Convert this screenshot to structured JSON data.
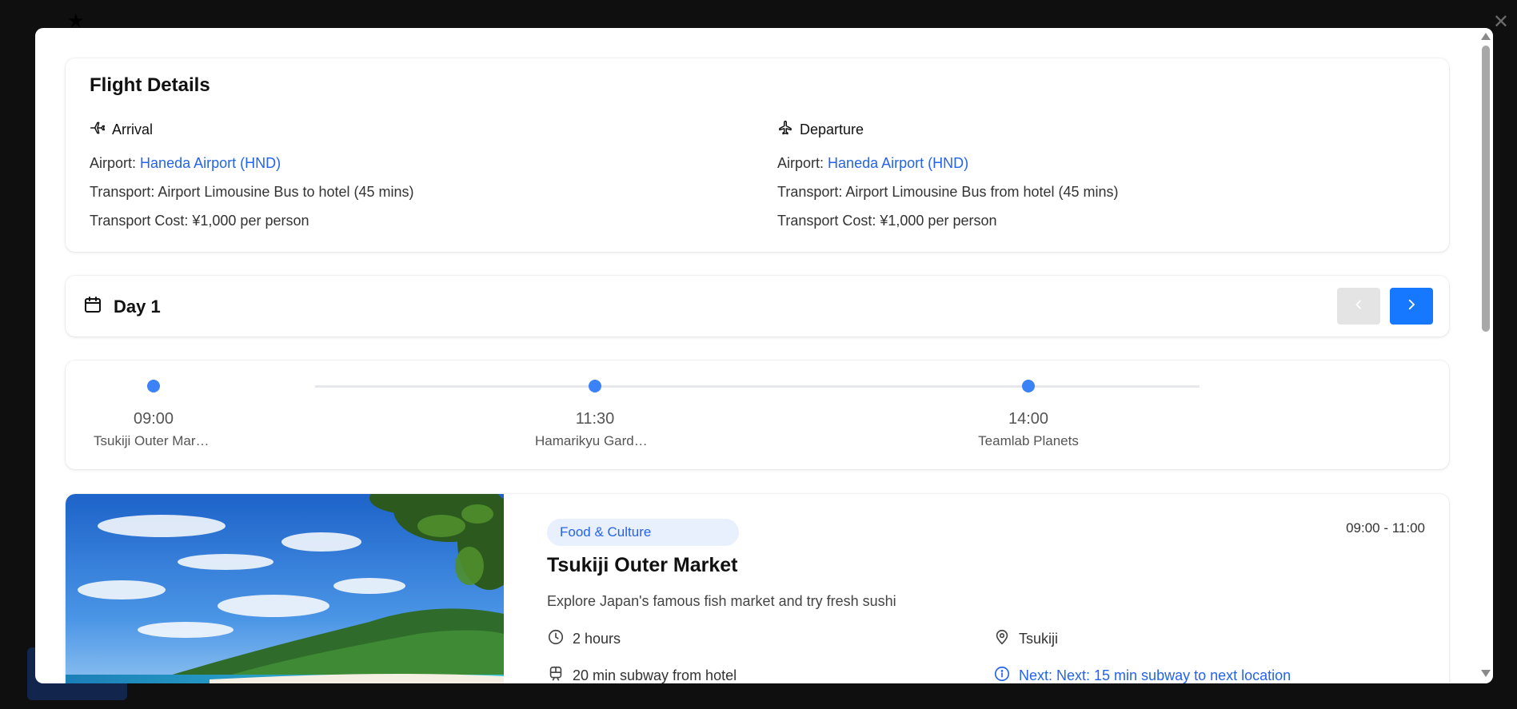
{
  "flight": {
    "title": "Flight Details",
    "arrival": {
      "label": "Arrival",
      "airport_label": "Airport:",
      "airport": "Haneda Airport (HND)",
      "transport": "Transport: Airport Limousine Bus to hotel (45 mins)",
      "cost": "Transport Cost: ¥1,000 per person"
    },
    "departure": {
      "label": "Departure",
      "airport_label": "Airport:",
      "airport": "Haneda Airport (HND)",
      "transport": "Transport: Airport Limousine Bus from hotel (45 mins)",
      "cost": "Transport Cost: ¥1,000 per person"
    }
  },
  "day": {
    "title": "Day 1"
  },
  "timeline": {
    "stops": [
      {
        "time": "09:00",
        "name": "Tsukiji Outer Market"
      },
      {
        "time": "11:30",
        "name": "Hamarikyu Gardens"
      },
      {
        "time": "14:00",
        "name": "Teamlab Planets"
      }
    ]
  },
  "activity": {
    "tag": "Food & Culture",
    "time_range": "09:00 - 11:00",
    "title": "Tsukiji Outer Market",
    "description": "Explore Japan's famous fish market and try fresh sushi",
    "duration": "2 hours",
    "location": "Tsukiji",
    "transit": "20 min subway from hotel",
    "next": "Next: Next: 15 min subway to next location"
  },
  "colors": {
    "accent": "#1677ff",
    "link": "#2563eb",
    "timeline_dot": "#3b82f6"
  }
}
